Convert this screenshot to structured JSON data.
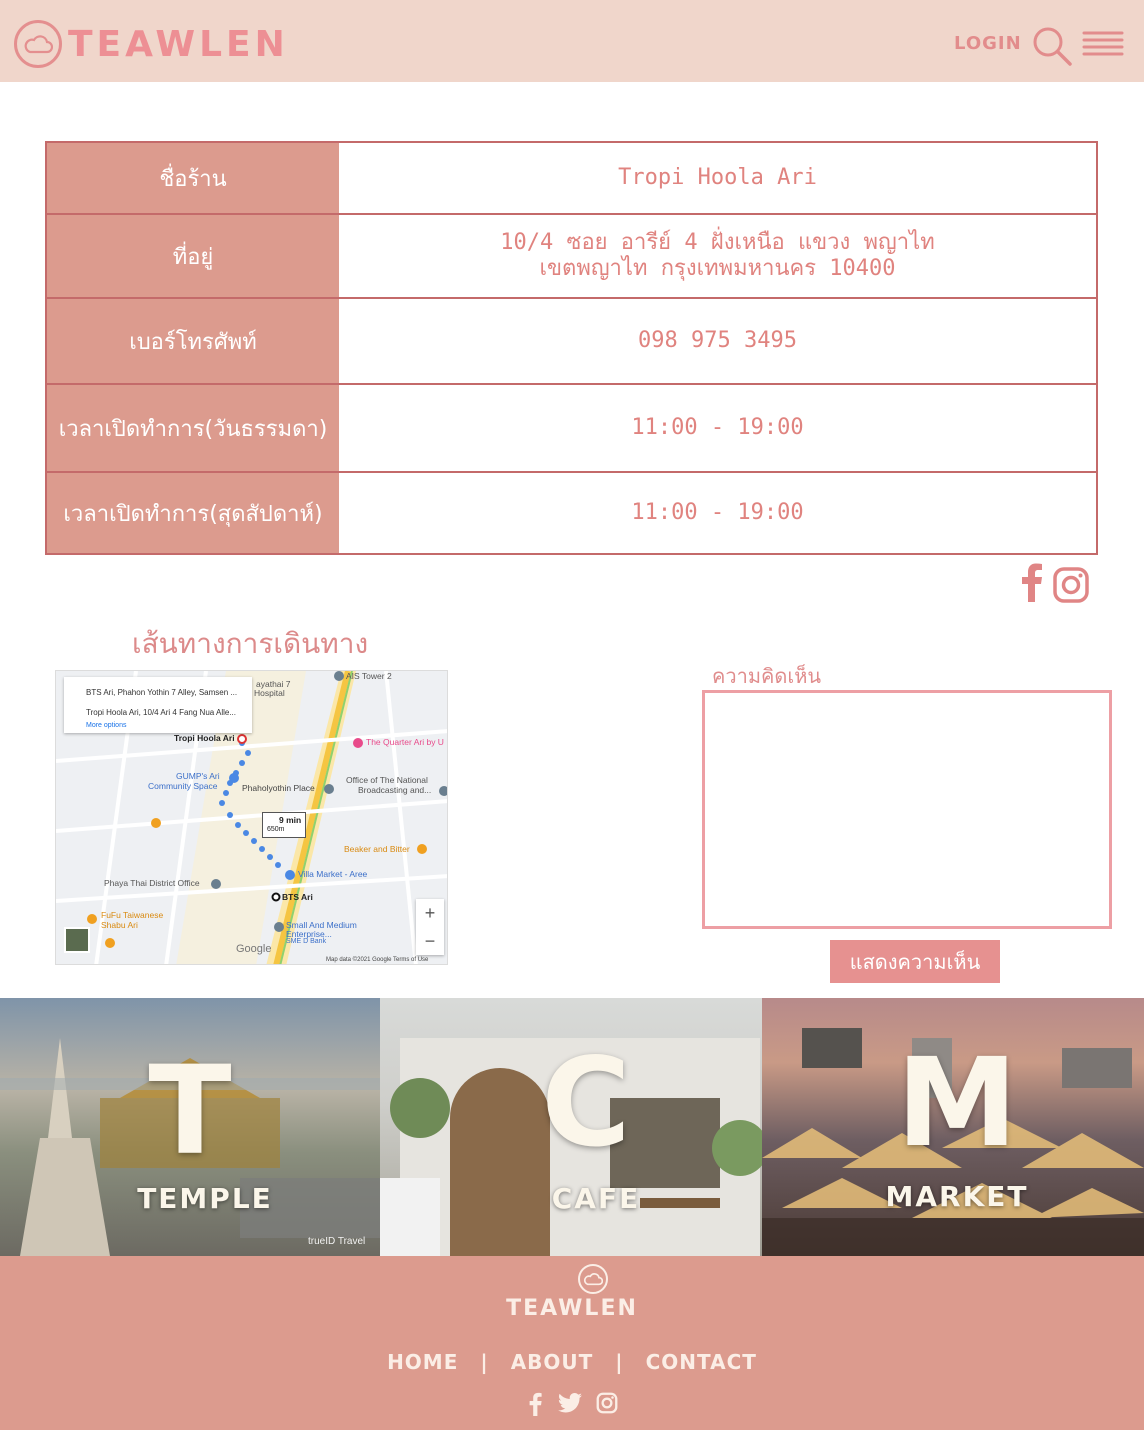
{
  "header": {
    "brand": "TEAWLEN",
    "login_label": "LOGIN",
    "icons": [
      "cloud-logo-icon",
      "search-icon",
      "menu-icon"
    ]
  },
  "shop_info": {
    "rows": [
      {
        "label": "ชื่อร้าน",
        "value_lines": [
          "Tropi Hoola Ari"
        ]
      },
      {
        "label": "ที่อยู่",
        "value_lines": [
          "10/4 ซอย อารีย์ 4 ฝั่งเหนือ แขวง พญาไท",
          "เขตพญาไท กรุงเทพมหานคร 10400"
        ]
      },
      {
        "label": "เบอร์โทรศัพท์",
        "value_lines": [
          "098 975 3495"
        ]
      },
      {
        "label": "เวลาเปิดทำการ(วันธรรมดา)",
        "value_lines": [
          "11:00 - 19:00"
        ]
      },
      {
        "label": "เวลาเปิดทำการ(สุดสัปดาห์)",
        "value_lines": [
          "11:00 - 19:00"
        ]
      }
    ],
    "social_icons": [
      "facebook-icon",
      "instagram-icon"
    ]
  },
  "map_section": {
    "title": "เส้นทางการเดินทาง",
    "directions": {
      "from": "BTS Ari, Phahon Yothin 7 Alley, Samsen ...",
      "to": "Tropi Hoola Ari, 10/4 Ari 4 Fang Nua Alle...",
      "more_options": "More options"
    },
    "labels": {
      "destination": "Tropi Hoola Ari",
      "ais": "AIS Tower 2",
      "hospital_1": "ayathai 7",
      "hospital_2": "Hospital",
      "quarter": "The Quarter Ari by U",
      "gumps_1": "GUMP's Ari",
      "gumps_2": "Community Space",
      "phaholyothin": "Phaholyothin Place",
      "office_1": "Office of The National",
      "office_2": "Broadcasting and...",
      "beaker": "Beaker and Bitter",
      "villa_1": "Villa Market - Aree",
      "district": "Phaya Thai District Office",
      "bts": "BTS Ari",
      "fufu_1": "FuFu Taiwanese",
      "fufu_2": "Shabu Ari",
      "sme_1": "Small And Medium",
      "sme_2": "Enterprise...",
      "sme_3": "SME D Bank",
      "walk_time": "9 min",
      "walk_dist": "650m",
      "google": "Google",
      "footer": "Map data ©2021 Google    Terms of Use",
      "zoom_in": "+",
      "zoom_out": "−"
    }
  },
  "comment": {
    "label": "ความคิดเห็น",
    "value": "",
    "button_label": "แสดงความเห็น"
  },
  "tiles": [
    {
      "letter": "T",
      "word": "TEMPLE",
      "credit": "trueID Travel"
    },
    {
      "letter": "C",
      "word": "CAFE"
    },
    {
      "letter": "M",
      "word": "MARKET"
    }
  ],
  "footer": {
    "brand": "TEAWLEN",
    "nav": [
      "HOME",
      "ABOUT",
      "CONTACT"
    ],
    "separator": "|",
    "social_icons": [
      "facebook-icon",
      "twitter-icon",
      "instagram-icon"
    ]
  },
  "colors": {
    "header_bg": "#f0d6cb",
    "accent": "#dc9b8e",
    "text_pink": "#e0837f",
    "footer_bg": "#dc9b8e"
  }
}
